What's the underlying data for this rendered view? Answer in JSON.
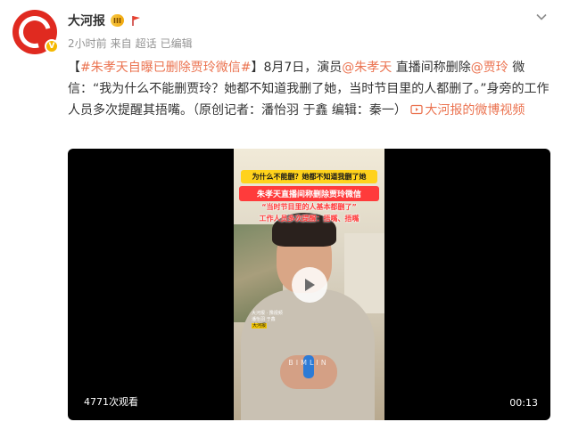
{
  "author": {
    "name": "大河报",
    "vip_badge": "III",
    "verified_mark": "V"
  },
  "meta": {
    "time": "2小时前",
    "source_prefix": "来自",
    "source": "超话",
    "edited": "已编辑"
  },
  "post": {
    "bracket_open": "【",
    "topic": "#朱孝天自曝已删除贾玲微信#",
    "bracket_close": "】",
    "text_1": "8月7日，演员",
    "mention_1": "@朱孝天",
    "text_2": " 直播间称删除",
    "mention_2": "@贾玲",
    "text_3": " 微信：“我为什么不能删贾玲？她都不知道我删了她，当时节目里的人都删了。”身旁的工作人员多次提醒其捂嘴。（原创记者：潘怡羽 于鑫 编辑：秦一）",
    "video_link": "大河报的微博视频"
  },
  "video": {
    "caption_1": "为什么不能删？她都不知道我删了她",
    "caption_2": "朱孝天直播间称删除贾玲微信",
    "caption_3": "“当时节目里的人基本都删了”",
    "caption_4": "工作人员多次提醒：捂嘴、捂嘴",
    "lower_third_1": "大河报 · 豫视频",
    "lower_third_2": "潘怡羽 于鑫",
    "lower_third_hl": "大河报",
    "watermark": "BIMLIN",
    "views": "4771次观看",
    "duration": "00:13"
  },
  "colors": {
    "link": "#eb7350",
    "brand_red": "#e02a20",
    "meta_gray": "#939393"
  }
}
